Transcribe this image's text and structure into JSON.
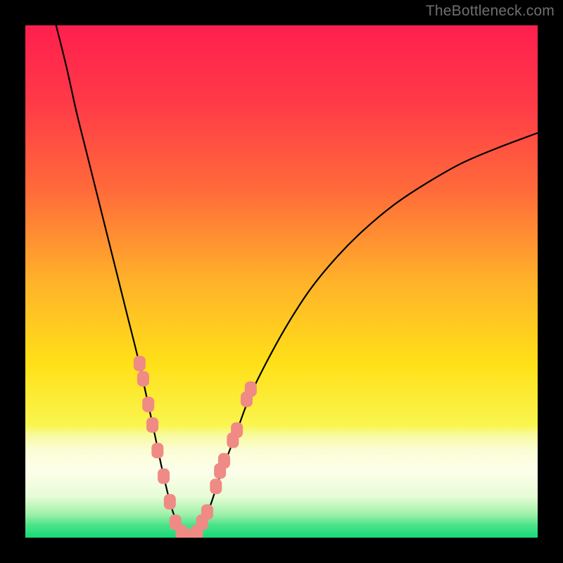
{
  "watermark": "TheBottleneck.com",
  "chart_data": {
    "type": "line",
    "title": "",
    "xlabel": "",
    "ylabel": "",
    "xlim": [
      0,
      100
    ],
    "ylim": [
      0,
      100
    ],
    "grid": false,
    "legend": false,
    "annotations": "Rounded salmon markers overlaid on a subset of the curve near its minimum.",
    "background_gradient_stops": [
      {
        "offset": 0.0,
        "color": "#ff1f4e"
      },
      {
        "offset": 0.15,
        "color": "#ff3a48"
      },
      {
        "offset": 0.32,
        "color": "#ff6a3a"
      },
      {
        "offset": 0.5,
        "color": "#ffb22a"
      },
      {
        "offset": 0.66,
        "color": "#ffe018"
      },
      {
        "offset": 0.78,
        "color": "#faf54e"
      },
      {
        "offset": 0.8,
        "color": "#f7fa9e"
      },
      {
        "offset": 0.83,
        "color": "#fbfdd6"
      },
      {
        "offset": 0.87,
        "color": "#fdfeea"
      },
      {
        "offset": 0.92,
        "color": "#e6fcd6"
      },
      {
        "offset": 0.955,
        "color": "#9df0a8"
      },
      {
        "offset": 0.975,
        "color": "#4de38a"
      },
      {
        "offset": 1.0,
        "color": "#17d977"
      }
    ],
    "series": [
      {
        "name": "bottleneck-curve",
        "color": "#000000",
        "x": [
          6,
          8,
          10,
          12,
          14,
          16,
          18,
          20,
          22,
          24,
          25.5,
          27,
          28.5,
          30,
          31,
          32,
          33,
          34,
          36,
          38,
          41,
          44,
          48,
          52,
          56,
          61,
          66,
          72,
          78,
          85,
          92,
          100
        ],
        "y": [
          100,
          92,
          83,
          75,
          67,
          59,
          51,
          43,
          35,
          26,
          19,
          12,
          6,
          2,
          0.5,
          0,
          0.5,
          2,
          6,
          12,
          20,
          28,
          36,
          43,
          49,
          55,
          60,
          65,
          69,
          73,
          76,
          79
        ]
      }
    ],
    "markers": {
      "name": "highlight-markers",
      "color": "#ef8a85",
      "points": [
        {
          "x": 22.3,
          "y": 34
        },
        {
          "x": 23.0,
          "y": 31
        },
        {
          "x": 24.0,
          "y": 26
        },
        {
          "x": 24.8,
          "y": 22
        },
        {
          "x": 25.8,
          "y": 17
        },
        {
          "x": 27.0,
          "y": 12
        },
        {
          "x": 28.2,
          "y": 7
        },
        {
          "x": 29.3,
          "y": 3
        },
        {
          "x": 30.5,
          "y": 1
        },
        {
          "x": 31.5,
          "y": 0.2
        },
        {
          "x": 32.5,
          "y": 0.2
        },
        {
          "x": 33.5,
          "y": 1
        },
        {
          "x": 34.5,
          "y": 3
        },
        {
          "x": 35.5,
          "y": 5
        },
        {
          "x": 37.2,
          "y": 10
        },
        {
          "x": 38.0,
          "y": 13
        },
        {
          "x": 38.8,
          "y": 15
        },
        {
          "x": 40.5,
          "y": 19
        },
        {
          "x": 41.3,
          "y": 21
        },
        {
          "x": 43.2,
          "y": 27
        },
        {
          "x": 44.0,
          "y": 29
        }
      ]
    }
  }
}
